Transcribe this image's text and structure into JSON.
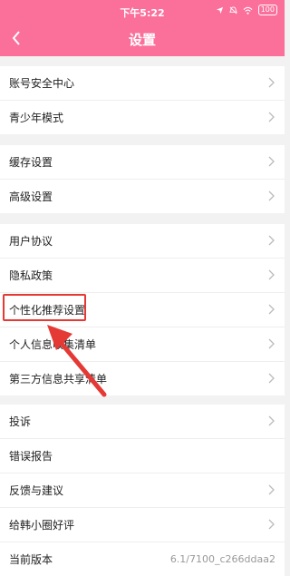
{
  "status_bar": {
    "time": "下午5:22",
    "battery": "100"
  },
  "nav": {
    "title": "设置",
    "back_icon": "chevron-left-icon"
  },
  "sections": [
    {
      "items": [
        {
          "label": "账号安全中心"
        },
        {
          "label": "青少年模式"
        }
      ]
    },
    {
      "items": [
        {
          "label": "缓存设置"
        },
        {
          "label": "高级设置"
        }
      ]
    },
    {
      "items": [
        {
          "label": "用户协议"
        },
        {
          "label": "隐私政策"
        },
        {
          "label": "个性化推荐设置"
        },
        {
          "label": "个人信息收集清单"
        },
        {
          "label": "第三方信息共享清单"
        }
      ]
    },
    {
      "items": [
        {
          "label": "投诉"
        },
        {
          "label": "错误报告"
        },
        {
          "label": "反馈与建议"
        },
        {
          "label": "给韩小圈好评"
        },
        {
          "label": "当前版本",
          "value": "6.1/7100_c266ddaa2"
        }
      ]
    }
  ],
  "colors": {
    "header": "#fb6f9b",
    "highlight": "#e53935"
  }
}
